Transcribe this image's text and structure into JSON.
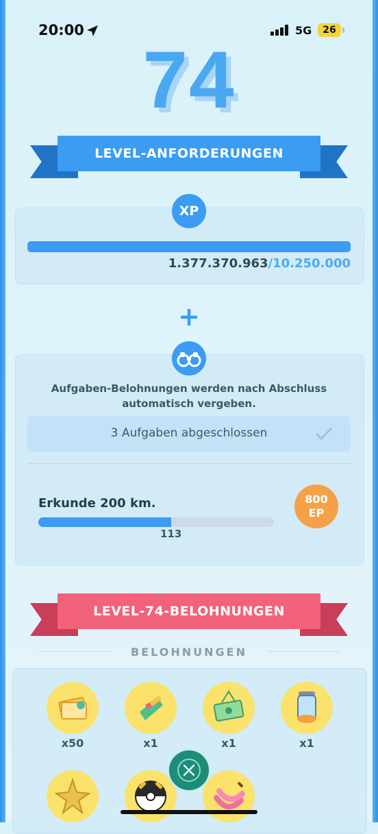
{
  "status_bar": {
    "time": "20:00",
    "network": "5G",
    "battery": "26"
  },
  "level": {
    "number": "74"
  },
  "requirements": {
    "title": "LEVEL-ANFORDERUNGEN",
    "xp": {
      "badge": "XP",
      "current": "1.377.370.963",
      "goal": "/10.250.000",
      "progress": 1.0
    },
    "plus": "+",
    "tasks": {
      "description": "Aufgaben-Belohnungen werden nach Abschluss automatisch vergeben.",
      "completed_label": "3 Aufgaben abgeschlossen",
      "item": {
        "label": "Erkunde 200 km.",
        "current": "113",
        "target": 200,
        "reward_amount": "800",
        "reward_unit": "EP"
      }
    }
  },
  "rewards": {
    "title": "LEVEL-74-BELOHNUNGEN",
    "heading": "BELOHNUNGEN",
    "items": [
      {
        "icon": "pass-ticket-icon",
        "count": "x50"
      },
      {
        "icon": "incense-icon",
        "count": "x1"
      },
      {
        "icon": "lucky-egg-package-icon",
        "count": "x1"
      },
      {
        "icon": "incubator-icon",
        "count": "x1"
      },
      {
        "icon": "star-piece-icon",
        "count": ""
      },
      {
        "icon": "ultra-ball-icon",
        "count": ""
      },
      {
        "icon": "banana-berry-icon",
        "count": ""
      }
    ]
  },
  "colors": {
    "accent": "#3b9cf2",
    "ribbon_red": "#f2627a",
    "ep_orange": "#f5a149",
    "reward_yellow": "#fae26b"
  }
}
